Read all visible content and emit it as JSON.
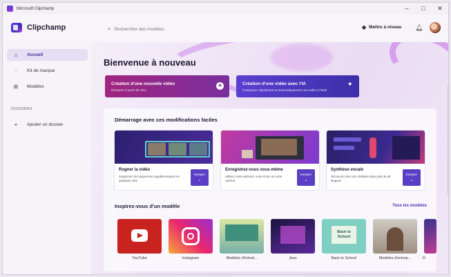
{
  "window": {
    "title": "Microsoft Clipchamp",
    "controls": {
      "minimize": "–",
      "maximize": "□",
      "close": "✕"
    }
  },
  "header": {
    "app_name": "Clipchamp",
    "search_placeholder": "Rechercher des modèles",
    "upgrade_label": "Mettre à niveau",
    "icons": [
      "search-icon",
      "gem-icon",
      "bell-icon",
      "avatar"
    ]
  },
  "sidebar": {
    "items": [
      {
        "label": "Accueil",
        "icon": "home-icon",
        "active": true
      },
      {
        "label": "Kit de marque",
        "icon": "brand-kit-icon",
        "active": false
      },
      {
        "label": "Modèles",
        "icon": "templates-icon",
        "active": false
      }
    ],
    "section_label": "DOSSIERS",
    "add_folder_label": "Ajouter un dossier"
  },
  "main": {
    "welcome": "Bienvenue à nouveau",
    "cta": [
      {
        "title": "Création d'une nouvelle vidéo",
        "subtitle": "Démarrer à partir de zéro",
        "color": "#a0257f"
      },
      {
        "title": "Création d'une vidéo avec l'IA",
        "subtitle": "Composez rapidement et automatiquement une vidéo à l'aide",
        "color": "#5b3fd0"
      }
    ],
    "easy_edits_title": "Démarrage avec ces modifications faciles",
    "features": [
      {
        "name": "Rogner la vidéo",
        "desc": "Supprimez les séquences supplémentaires en quelques clics",
        "button": "Essayer"
      },
      {
        "name": "Enregistrez-vous vous-même",
        "desc": "Utilisez votre webcam, votre écran ou votre caméra",
        "button": "Essayer"
      },
      {
        "name": "Synthèse vocale",
        "desc": "Découvrez des voix réalistes dans plus de 80 langues",
        "button": "Essayer"
      }
    ],
    "templates_title": "Inspirez-vous d'un modèle",
    "see_all": "Tous les modèles",
    "templates": [
      {
        "label": "YouTube"
      },
      {
        "label": "Instagram"
      },
      {
        "label": "Modèles d'introd..."
      },
      {
        "label": "Jeux"
      },
      {
        "label": "Back to School"
      },
      {
        "label": "Modèles d'entrep..."
      },
      {
        "label": "D"
      }
    ],
    "back_to_school_text": "Back to School"
  }
}
